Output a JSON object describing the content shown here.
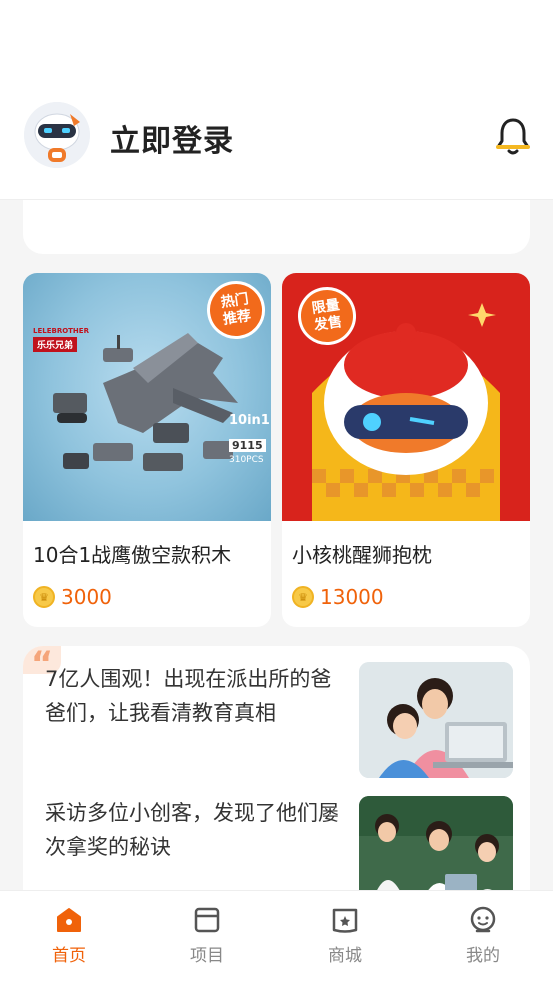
{
  "header": {
    "login_label": "立即登录"
  },
  "products": [
    {
      "name": "10合1战鹰傲空款积木",
      "price": "3000",
      "badge_line1": "热门",
      "badge_line2": "推荐",
      "brand": "LELEBROTHER",
      "brand_cn": "乐乐兄弟",
      "box_text": "10in1",
      "box_model": "9115",
      "box_pcs": "310PCS"
    },
    {
      "name": "小核桃醒狮抱枕",
      "price": "13000",
      "badge_line1": "限量",
      "badge_line2": "发售"
    }
  ],
  "articles": [
    {
      "title": "7亿人围观！出现在派出所的爸爸们，让我看清教育真相"
    },
    {
      "title": "采访多位小创客，发现了他们屡次拿奖的秘诀"
    }
  ],
  "tabs": [
    {
      "label": "首页",
      "icon": "home-icon",
      "active": true
    },
    {
      "label": "项目",
      "icon": "project-icon",
      "active": false
    },
    {
      "label": "商城",
      "icon": "store-icon",
      "active": false
    },
    {
      "label": "我的",
      "icon": "profile-icon",
      "active": false
    }
  ],
  "colors": {
    "accent": "#f0620a",
    "coin": "#f7c948"
  }
}
